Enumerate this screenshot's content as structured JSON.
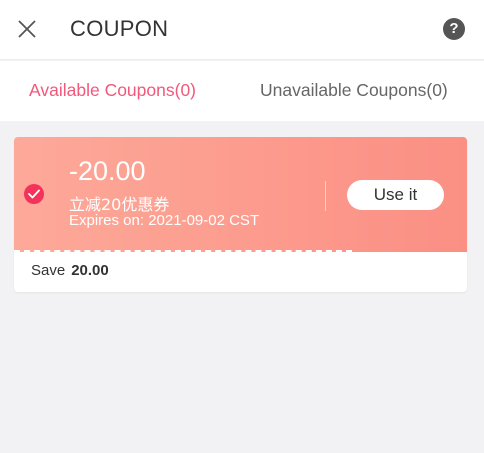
{
  "header": {
    "title": "COUPON",
    "close_icon": "close-icon",
    "help_icon": "help-icon",
    "help_glyph": "?"
  },
  "tabs": [
    {
      "label": "Available Coupons(0)",
      "active": true
    },
    {
      "label": "Unavailable Coupons(0)",
      "active": false
    }
  ],
  "coupon": {
    "amount": "-20.00",
    "name": "立减20优惠券",
    "expires": "Expires on: 2021-09-02 CST",
    "use_label": "Use it",
    "save_label": "Save",
    "save_value": "20.00",
    "selected": true
  },
  "colors": {
    "accent": "#f2587a",
    "coupon_gradient_start": "#fda999",
    "coupon_gradient_end": "#fb8f84",
    "check": "#f4335a",
    "background": "#f2f2f4"
  }
}
